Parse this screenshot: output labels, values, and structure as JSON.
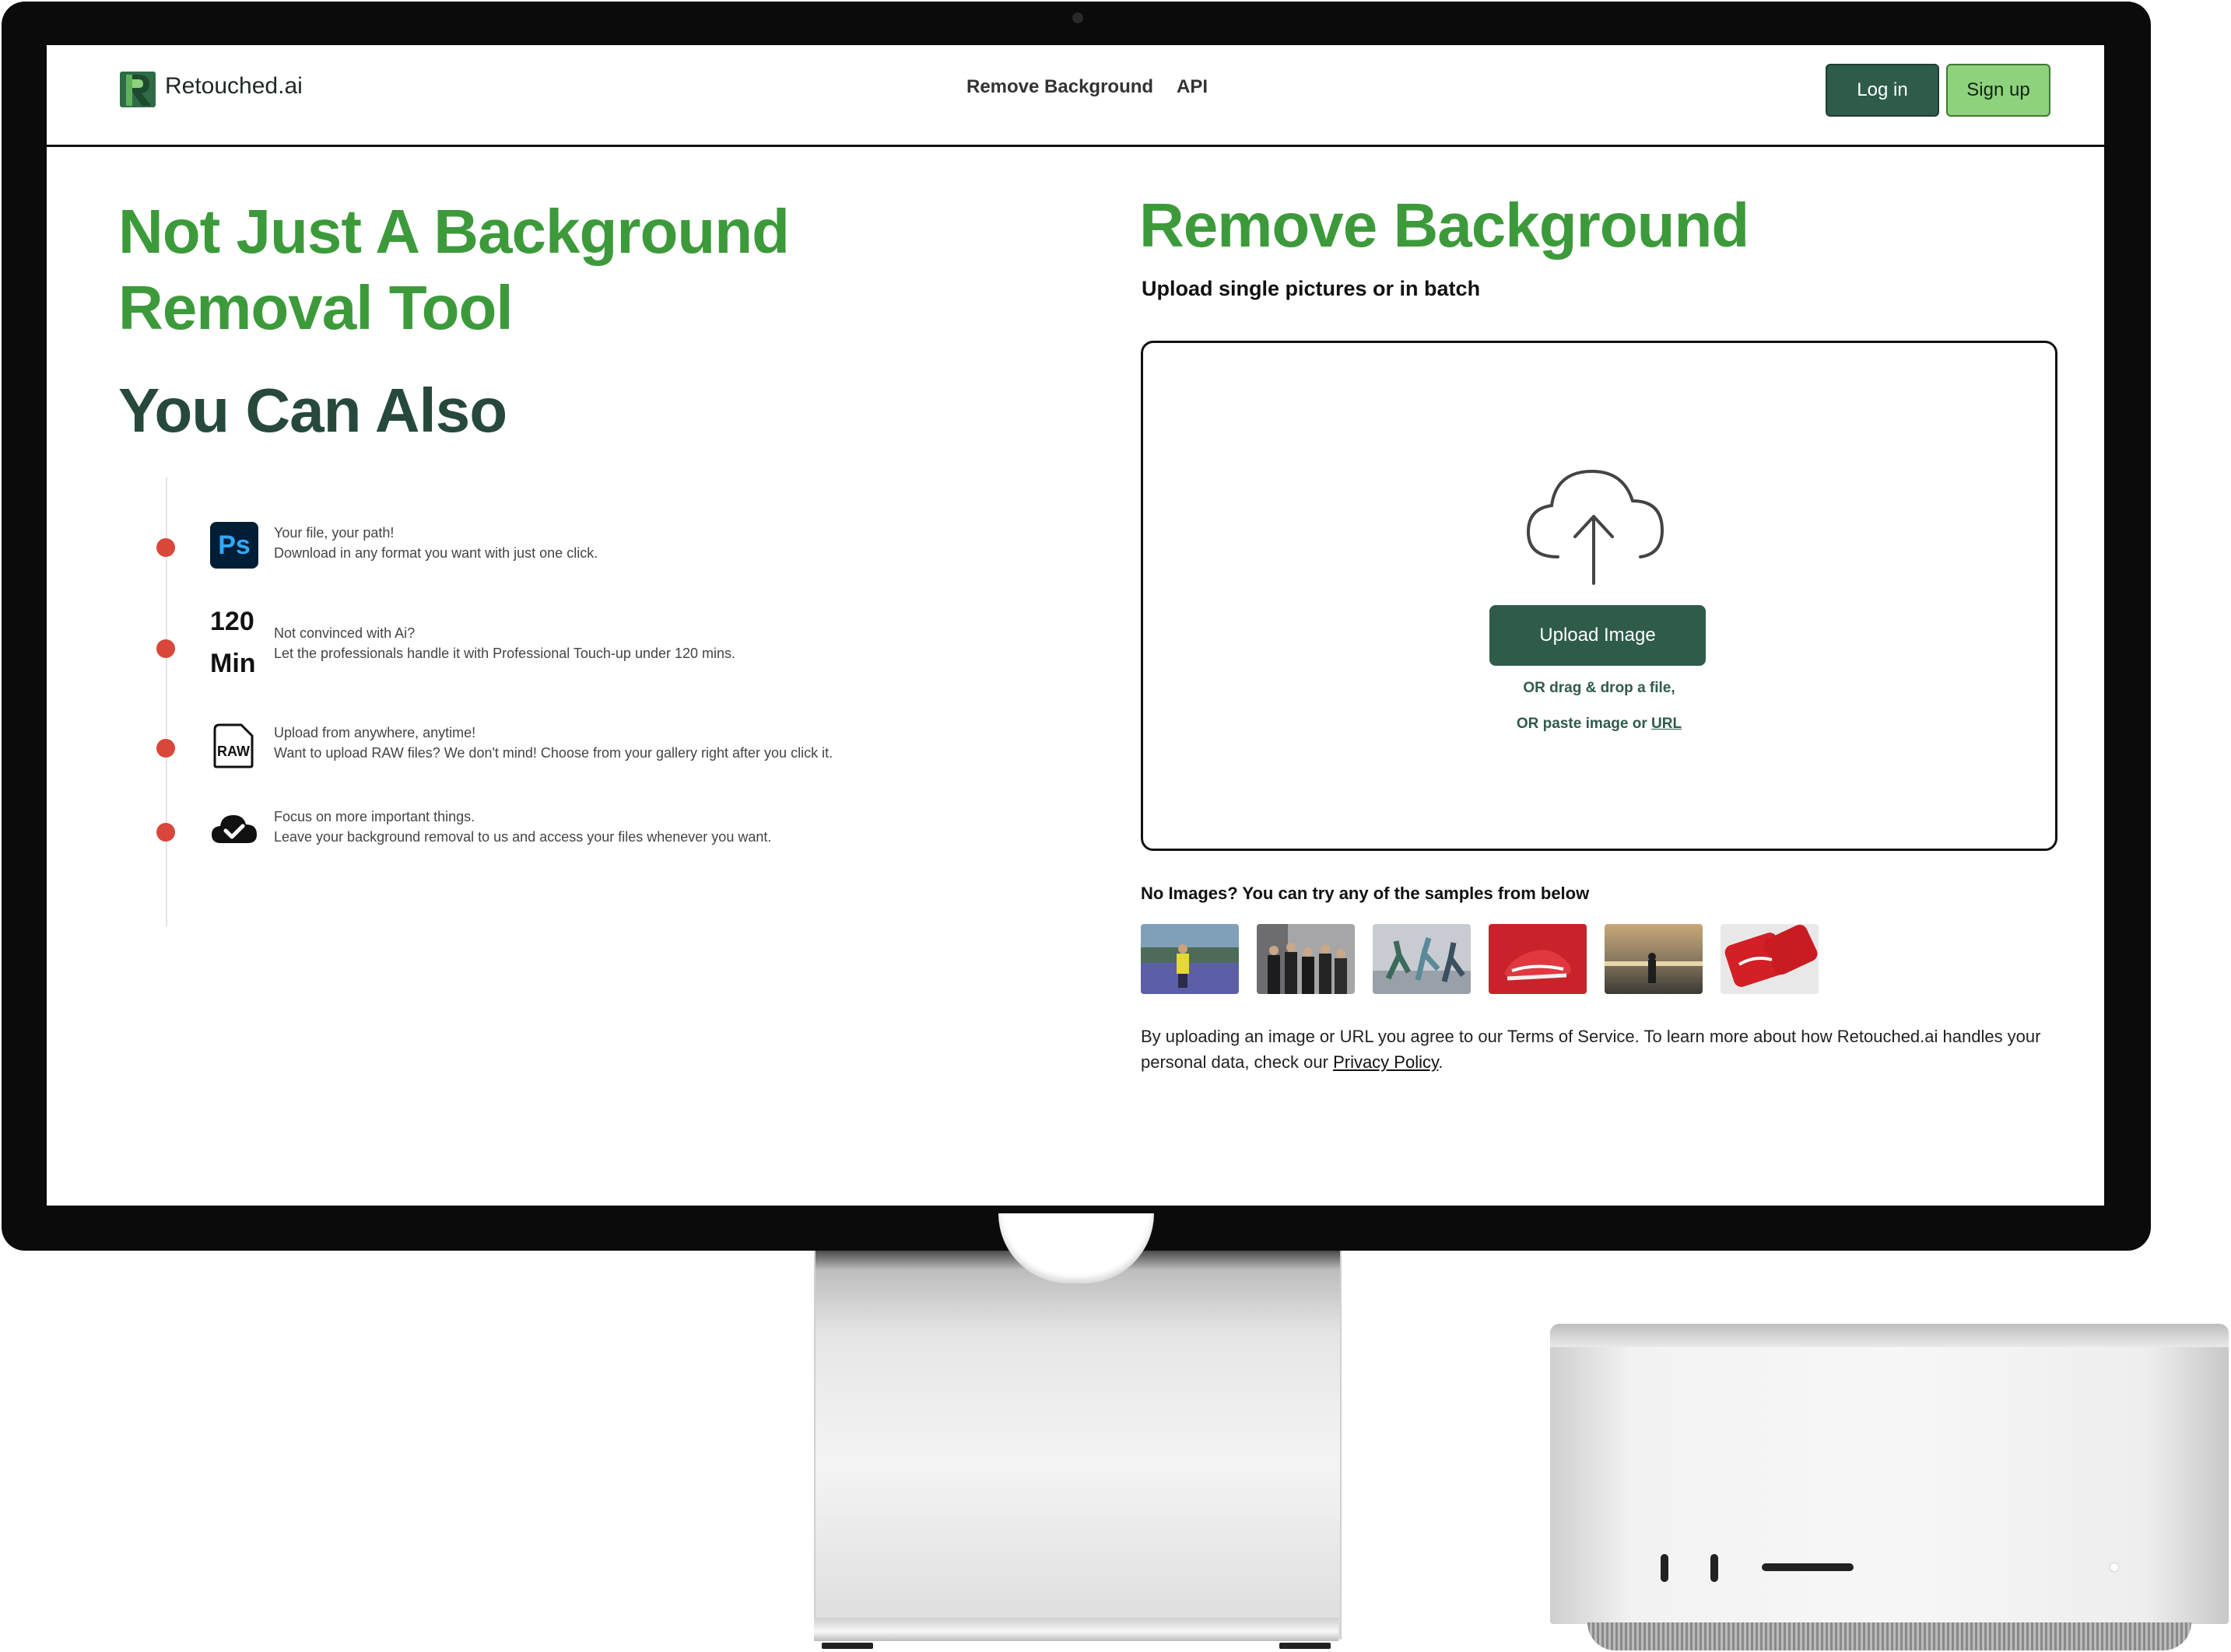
{
  "nav": {
    "brand": "Retouched.ai",
    "links": [
      "Remove Background",
      "API"
    ],
    "login_label": "Log in",
    "signup_label": "Sign up"
  },
  "left": {
    "headline_line1": "Not Just A Background",
    "headline_line2": "Removal Tool",
    "subhead": "You Can Also",
    "features": [
      {
        "icon": "photoshop-icon",
        "badge": "Ps",
        "title": "Your file, your path!",
        "desc": "Download in any format you want with just one click."
      },
      {
        "icon": "time-120-min",
        "badge_line1": "120",
        "badge_line2": "Min",
        "title": "Not convinced with Ai?",
        "desc": "Let the professionals handle it with Professional Touch-up under 120 mins."
      },
      {
        "icon": "raw-file-icon",
        "badge": "RAW",
        "title": "Upload from anywhere, anytime!",
        "desc": "Want to upload RAW files? We don't mind! Choose from your gallery right after you click it."
      },
      {
        "icon": "cloud-check-icon",
        "title": "Focus on more important things.",
        "desc": "Leave your background removal to us and access your files whenever you want."
      }
    ]
  },
  "right": {
    "title": "Remove Background",
    "subtitle": "Upload single pictures or in batch",
    "upload_label": "Upload Image",
    "or_drag": "OR drag & drop a file,",
    "or_paste": "OR paste image or",
    "url_link": "URL",
    "samples_label": "No Images? You can try any of the samples from below",
    "samples": [
      "sample-person-field",
      "sample-group-men",
      "sample-dancers",
      "sample-red-shoe",
      "sample-beach-sunset",
      "sample-cola-cans"
    ],
    "legal_text": "By uploading an image or URL you agree to our Terms of Service. To learn more about how Retouched.ai handles your personal data, check our",
    "privacy_link": "Privacy Policy",
    "legal_end": "."
  },
  "colors": {
    "brand_green": "#3c9a3a",
    "dark_green": "#2f5b4a",
    "signup_green": "#8fd27d",
    "bullet_red": "#d9463a"
  }
}
